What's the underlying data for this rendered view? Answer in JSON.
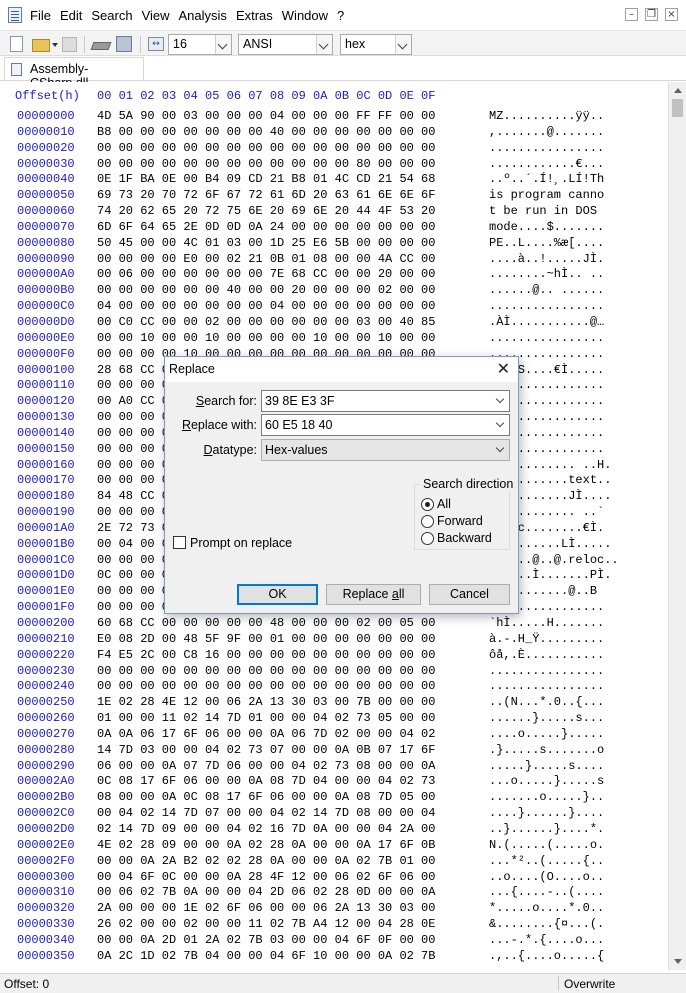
{
  "menubar": {
    "items": [
      "File",
      "Edit",
      "Search",
      "View",
      "Analysis",
      "Extras",
      "Window",
      "?"
    ]
  },
  "toolbar": {
    "bytes_per_row": "16",
    "charset": "ANSI",
    "offset_base": "hex"
  },
  "tab": {
    "label": "Assembly-CSharp.dll"
  },
  "hexview": {
    "header_offset": "Offset(h)",
    "header_columns": "00 01 02 03 04 05 06 07 08 09 0A 0B 0C 0D 0E 0F",
    "rows": [
      {
        "offset": "00000000",
        "bytes": "4D 5A 90 00 03 00 00 00 04 00 00 00 FF FF 00 00",
        "ascii": "MZ..........ÿÿ.."
      },
      {
        "offset": "00000010",
        "bytes": "B8 00 00 00 00 00 00 00 40 00 00 00 00 00 00 00",
        "ascii": ",.......@......."
      },
      {
        "offset": "00000020",
        "bytes": "00 00 00 00 00 00 00 00 00 00 00 00 00 00 00 00",
        "ascii": "................"
      },
      {
        "offset": "00000030",
        "bytes": "00 00 00 00 00 00 00 00 00 00 00 00 80 00 00 00",
        "ascii": "............€..."
      },
      {
        "offset": "00000040",
        "bytes": "0E 1F BA 0E 00 B4 09 CD 21 B8 01 4C CD 21 54 68",
        "ascii": "..º..´.Í!¸.LÍ!Th"
      },
      {
        "offset": "00000050",
        "bytes": "69 73 20 70 72 6F 67 72 61 6D 20 63 61 6E 6E 6F",
        "ascii": "is program canno"
      },
      {
        "offset": "00000060",
        "bytes": "74 20 62 65 20 72 75 6E 20 69 6E 20 44 4F 53 20",
        "ascii": "t be run in DOS "
      },
      {
        "offset": "00000070",
        "bytes": "6D 6F 64 65 2E 0D 0D 0A 24 00 00 00 00 00 00 00",
        "ascii": "mode....$......."
      },
      {
        "offset": "00000080",
        "bytes": "50 45 00 00 4C 01 03 00 1D 25 E6 5B 00 00 00 00",
        "ascii": "PE..L....%æ[...."
      },
      {
        "offset": "00000090",
        "bytes": "00 00 00 00 E0 00 02 21 0B 01 08 00 00 4A CC 00",
        "ascii": "....à..!.....JÌ."
      },
      {
        "offset": "000000A0",
        "bytes": "00 06 00 00 00 00 00 00 7E 68 CC 00 00 20 00 00",
        "ascii": "........~hÌ.. .."
      },
      {
        "offset": "000000B0",
        "bytes": "00 00 00 00 00 00 40 00 00 20 00 00 00 02 00 00",
        "ascii": "......@.. ......"
      },
      {
        "offset": "000000C0",
        "bytes": "04 00 00 00 00 00 00 00 04 00 00 00 00 00 00 00",
        "ascii": "................"
      },
      {
        "offset": "000000D0",
        "bytes": "00 C0 CC 00 00 02 00 00 00 00 00 00 03 00 40 85",
        "ascii": ".ÀÌ...........@…"
      },
      {
        "offset": "000000E0",
        "bytes": "00 00 10 00 00 10 00 00 00 00 10 00 00 10 00 00",
        "ascii": "................"
      },
      {
        "offset": "000000F0",
        "bytes": "00 00 00 00 10 00 00 00 00 00 00 00 00 00 00 00",
        "ascii": "................"
      },
      {
        "offset": "00000100",
        "bytes": "28 68 CC 00 53 00 00 00 00 00 00 00 00 00 00 00",
        "ascii": "(hÌ.S....€Ì....."
      },
      {
        "offset": "00000110",
        "bytes": "00 00 00 00 00 00 00 00 00 00 00 00 00 00 00 00",
        "ascii": "................"
      },
      {
        "offset": "00000120",
        "bytes": "00 A0 CC 00 00 00 00 00 00 00 00 00 00 00 00 00",
        "ascii": "................"
      },
      {
        "offset": "00000130",
        "bytes": "00 00 00 00 00 00 00 00 00 00 00 00 00 00 00 00",
        "ascii": "................"
      },
      {
        "offset": "00000140",
        "bytes": "00 00 00 00 00 00 00 00 00 00 00 00 00 00 00 00",
        "ascii": "................"
      },
      {
        "offset": "00000150",
        "bytes": "00 00 00 00 00 00 00 00 00 00 00 00 00 00 00 00",
        "ascii": "................"
      },
      {
        "offset": "00000160",
        "bytes": "00 00 00 00 00 00 00 00 00 00 00 00 00 00 00 00",
        "ascii": "............ ..H."
      },
      {
        "offset": "00000170",
        "bytes": "00 00 00 00 00 00 00 00 00 00 00 00 00 00 00 00",
        "ascii": "...........text.."
      },
      {
        "offset": "00000180",
        "bytes": "84 48 CC 00 00 00 00 00 00 00 00 00 00 00 00 00",
        "ascii": "„HÌ........JÌ...."
      },
      {
        "offset": "00000190",
        "bytes": "00 00 00 00 00 00 00 00 00 00 00 00 00 00 00 00",
        "ascii": "............ ..`"
      },
      {
        "offset": "000001A0",
        "bytes": "2E 72 73 00 00 00 00 00 00 00 00 00 00 00 00 00",
        "ascii": ".rsrc........€Ì."
      },
      {
        "offset": "000001B0",
        "bytes": "00 04 00 00 00 00 00 00 00 00 00 00 00 00 00 00",
        "ascii": "..........LÌ....."
      },
      {
        "offset": "000001C0",
        "bytes": "00 00 00 00 00 00 00 00 00 00 00 00 00 00 00 00",
        "ascii": "......@..@.reloc.."
      },
      {
        "offset": "000001D0",
        "bytes": "0C 00 00 00 00 00 00 00 00 00 00 00 00 00 00 00",
        "ascii": "......Ì.......PÌ."
      },
      {
        "offset": "000001E0",
        "bytes": "00 00 00 00 00 00 00 00 00 00 00 00 00 00 00 00",
        "ascii": "...........@..B"
      },
      {
        "offset": "000001F0",
        "bytes": "00 00 00 00 00 00 00 00 00 00 00 00 00 00 00 00",
        "ascii": "................"
      },
      {
        "offset": "00000200",
        "bytes": "60 68 CC 00 00 00 00 00 48 00 00 00 02 00 05 00",
        "ascii": "`hÌ.....H......."
      },
      {
        "offset": "00000210",
        "bytes": "E0 08 2D 00 48 5F 9F 00 01 00 00 00 00 00 00 00",
        "ascii": "à.-.H_Ÿ........."
      },
      {
        "offset": "00000220",
        "bytes": "F4 E5 2C 00 C8 16 00 00 00 00 00 00 00 00 00 00",
        "ascii": "ôå,.È..........."
      },
      {
        "offset": "00000230",
        "bytes": "00 00 00 00 00 00 00 00 00 00 00 00 00 00 00 00",
        "ascii": "................"
      },
      {
        "offset": "00000240",
        "bytes": "00 00 00 00 00 00 00 00 00 00 00 00 00 00 00 00",
        "ascii": "................"
      },
      {
        "offset": "00000250",
        "bytes": "1E 02 28 4E 12 00 06 2A 13 30 03 00 7B 00 00 00",
        "ascii": "..(N...*.0..{..."
      },
      {
        "offset": "00000260",
        "bytes": "01 00 00 11 02 14 7D 01 00 00 04 02 73 05 00 00",
        "ascii": "......}.....s..."
      },
      {
        "offset": "00000270",
        "bytes": "0A 0A 06 17 6F 06 00 00 0A 06 7D 02 00 00 04 02",
        "ascii": "....o.....}....."
      },
      {
        "offset": "00000280",
        "bytes": "14 7D 03 00 00 04 02 73 07 00 00 0A 0B 07 17 6F",
        "ascii": ".}.....s.......o"
      },
      {
        "offset": "00000290",
        "bytes": "06 00 00 0A 07 7D 06 00 00 04 02 73 08 00 00 0A",
        "ascii": ".....}.....s...."
      },
      {
        "offset": "000002A0",
        "bytes": "0C 08 17 6F 06 00 00 0A 08 7D 04 00 00 04 02 73",
        "ascii": "...o.....}.....s"
      },
      {
        "offset": "000002B0",
        "bytes": "08 00 00 0A 0C 08 17 6F 06 00 00 0A 08 7D 05 00",
        "ascii": ".......o.....}.."
      },
      {
        "offset": "000002C0",
        "bytes": "00 04 02 14 7D 07 00 00 04 02 14 7D 08 00 00 04",
        "ascii": "....}......}...."
      },
      {
        "offset": "000002D0",
        "bytes": "02 14 7D 09 00 00 04 02 16 7D 0A 00 00 04 2A 00",
        "ascii": "..}......}....*."
      },
      {
        "offset": "000002E0",
        "bytes": "4E 02 28 09 00 00 0A 02 28 0A 00 00 0A 17 6F 0B",
        "ascii": "N.(.....(.....o."
      },
      {
        "offset": "000002F0",
        "bytes": "00 00 0A 2A B2 02 02 28 0A 00 00 0A 02 7B 01 00",
        "ascii": "...*²..(.....{.."
      },
      {
        "offset": "00000300",
        "bytes": "00 04 6F 0C 00 00 0A 28 4F 12 00 06 02 6F 06 00",
        "ascii": "..o....(O....o.."
      },
      {
        "offset": "00000310",
        "bytes": "00 06 02 7B 0A 00 00 04 2D 06 02 28 0D 00 00 0A",
        "ascii": "...{....-..(...."
      },
      {
        "offset": "00000320",
        "bytes": "2A 00 00 00 1E 02 6F 06 00 00 06 2A 13 30 03 00",
        "ascii": "*.....o....*.0.."
      },
      {
        "offset": "00000330",
        "bytes": "26 02 00 00 02 00 00 11 02 7B A4 12 00 04 28 0E",
        "ascii": "&........{¤...(."
      },
      {
        "offset": "00000340",
        "bytes": "00 00 0A 2D 01 2A 02 7B 03 00 00 04 6F 0F 00 00",
        "ascii": "...-.*.{....o..."
      },
      {
        "offset": "00000350",
        "bytes": "0A 2C 1D 02 7B 04 00 00 04 6F 10 00 00 0A 02 7B",
        "ascii": ".,..{....o.....{"
      }
    ]
  },
  "statusbar": {
    "offset": "Offset: 0",
    "mode": "Overwrite"
  },
  "dialog": {
    "title": "Replace",
    "search_for_label": "Search for:",
    "search_for_value": "39 8E E3 3F",
    "replace_with_label": "Replace with:",
    "replace_with_value": "60 E5 18 40",
    "datatype_label": "Datatype:",
    "datatype_value": "Hex-values",
    "direction_title": "Search direction",
    "direction_options": [
      "All",
      "Forward",
      "Backward"
    ],
    "direction_selected": "All",
    "prompt_label": "Prompt on replace",
    "prompt_checked": false,
    "ok_label": "OK",
    "replace_all_label": "Replace all",
    "cancel_label": "Cancel"
  }
}
